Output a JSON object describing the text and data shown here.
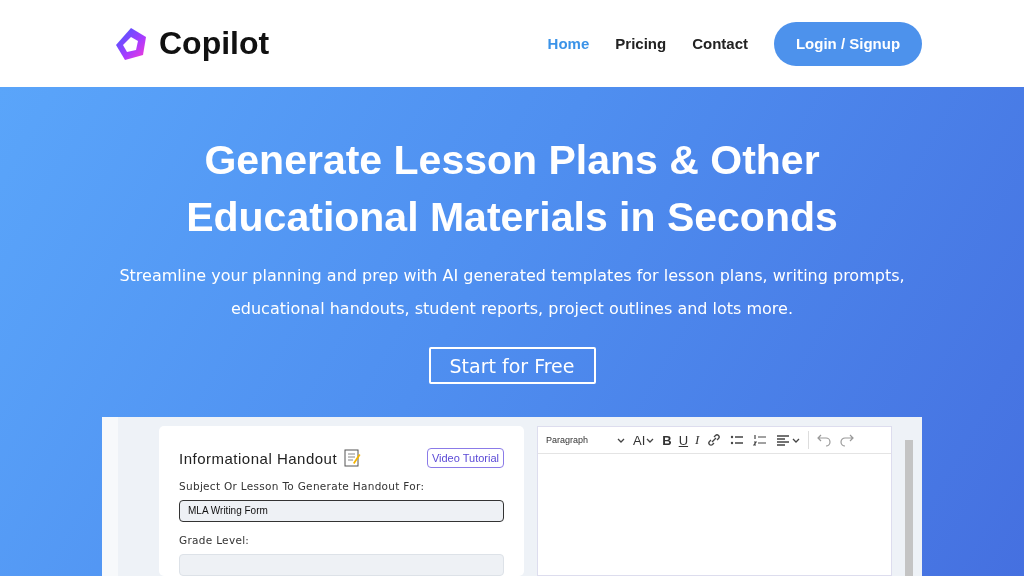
{
  "brand": {
    "name": "Copilot"
  },
  "nav": [
    {
      "label": "Home",
      "selected": true
    },
    {
      "label": "Pricing",
      "selected": false
    },
    {
      "label": "Contact",
      "selected": false
    }
  ],
  "login_button": "Login / Signup",
  "hero": {
    "title_lines": [
      "Generate Lesson Plans & Other",
      "Educational Materials in Seconds"
    ],
    "subtitle": "Streamline your planning and prep with AI generated templates for lesson plans, writing prompts, educational handouts, student reports, project outlines and lots more.",
    "cta": "Start for Free"
  },
  "preview": {
    "form": {
      "title": "Informational Handout",
      "video_button": "Video Tutorial",
      "fields": [
        {
          "label": "Subject Or Lesson To Generate Handout For:",
          "value": "MLA Writing Form",
          "focused": true
        },
        {
          "label": "Grade Level:",
          "focused": false
        }
      ]
    },
    "editor": {
      "toolbar": [
        {
          "kind": "select",
          "label": "Paragraph"
        },
        {
          "kind": "text-menu",
          "label": "AI"
        },
        {
          "kind": "text",
          "label": "B"
        },
        {
          "kind": "text",
          "label": "U"
        },
        {
          "kind": "text",
          "label": "I"
        },
        {
          "kind": "icon"
        },
        {
          "kind": "icon"
        },
        {
          "kind": "icon"
        },
        {
          "kind": "icon-menu"
        },
        {
          "kind": "divider"
        },
        {
          "kind": "icon"
        },
        {
          "kind": "icon"
        }
      ]
    }
  }
}
